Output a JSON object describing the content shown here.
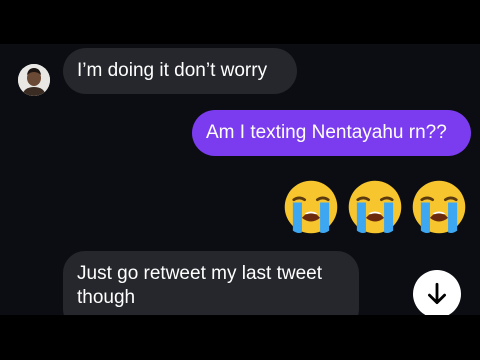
{
  "messages": [
    {
      "sender": "them",
      "text": "I’m doing it don’t worry"
    },
    {
      "sender": "me",
      "text": "Am I texting Nentayahu rn??"
    },
    {
      "sender": "me",
      "emoji": [
        "loudly-crying-face",
        "loudly-crying-face",
        "loudly-crying-face"
      ]
    },
    {
      "sender": "them",
      "text": "Just go retweet my last tweet though"
    }
  ],
  "colors": {
    "background": "#0b0d12",
    "incoming_bubble": "#26272c",
    "outgoing_bubble": "#7b3cf0"
  },
  "icons": {
    "avatar": "contact-avatar",
    "scroll_button": "arrow-down-icon"
  }
}
